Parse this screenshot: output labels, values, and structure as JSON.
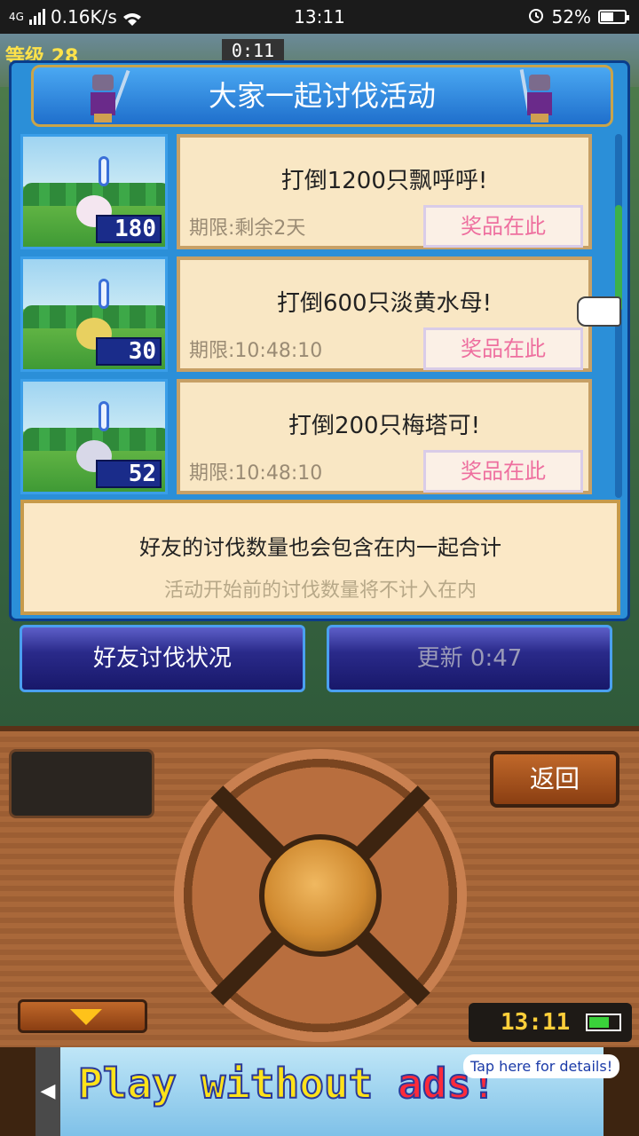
{
  "status_bar": {
    "network": "4G",
    "speed": "0.16K/s",
    "time": "13:11",
    "battery": "52%",
    "battery_level": 0.52
  },
  "game_hud": {
    "level_label": "等级",
    "level": "28",
    "timer": "0:11"
  },
  "dialog": {
    "title": "大家一起讨伐活动",
    "quests": [
      {
        "task": "打倒1200只飘呼呼!",
        "deadline": "期限:剩余2天",
        "prize_button": "奖品在此",
        "count": "180",
        "monster_color": "#f4e6f0"
      },
      {
        "task": "打倒600只淡黄水母!",
        "deadline": "期限:10:48:10",
        "prize_button": "奖品在此",
        "count": "30",
        "monster_color": "#e8d060"
      },
      {
        "task": "打倒200只梅塔可!",
        "deadline": "期限:10:48:10",
        "prize_button": "奖品在此",
        "count": "52",
        "monster_color": "#d8d8e8"
      }
    ],
    "note_line1": "好友的讨伐数量也会包含在内一起合计",
    "note_line2": "活动开始前的讨伐数量将不计入在内"
  },
  "buttons": {
    "friend_status": "好友讨伐状况",
    "update": "更新 0:47"
  },
  "console": {
    "back": "返回",
    "clock": "13:11"
  },
  "ad": {
    "text_main": "Play without ",
    "text_red": "ads!",
    "tap": "Tap here for details!"
  },
  "colors": {
    "accent": "#2b8fd8",
    "prize_text": "#ee6f9f",
    "card_bg": "#f9e7c4"
  }
}
